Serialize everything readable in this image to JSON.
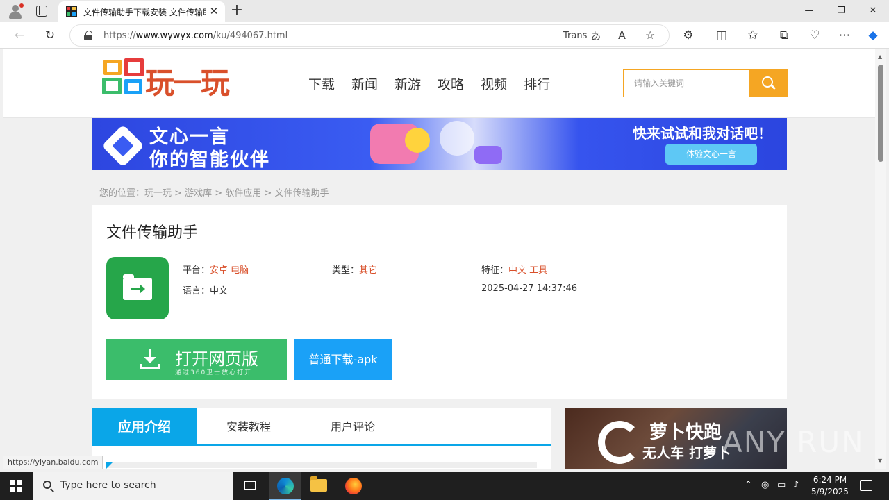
{
  "browser": {
    "tab_title": "文件传输助手下载安装 文件传输助手",
    "tab_close": "✕",
    "new_tab": "+",
    "window_controls": {
      "minimize": "—",
      "restore": "❐",
      "close": "✕"
    },
    "url_prefix": "https://",
    "url_host": "www.wywyx.com",
    "url_path": "/ku/494067.html",
    "translate_label": "Trans",
    "translate_glyph": "あ",
    "read_aloud_glyph": "A",
    "status_link": "https://yiyan.baidu.com"
  },
  "site": {
    "logo_text": "玩一玩",
    "nav": [
      "下载",
      "新闻",
      "新游",
      "攻略",
      "视频",
      "排行"
    ],
    "search_placeholder": "请输入关键词"
  },
  "banner": {
    "title_line1": "文心一言",
    "title_line2": "你的智能伙伴",
    "right_text": "快来试试和我对话吧！",
    "button_label": "体验文心一言"
  },
  "breadcrumb": "您的位置：玩一玩 > 游戏库 > 软件应用 > 文件传输助手",
  "app": {
    "title": "文件传输助手",
    "platform_label": "平台：",
    "platform_value": "安卓 电脑",
    "type_label": "类型：",
    "type_value": "其它",
    "feature_label": "特征：",
    "feature_value": "中文 工具",
    "language_label": "语言：",
    "language_value": "中文",
    "updated": "2025-04-27 14:37:46",
    "open_web_label": "打开网页版",
    "open_web_sub": "通过360卫士放心打开",
    "apk_label": "普通下载-apk"
  },
  "intro_tabs": [
    "应用介绍",
    "安装教程",
    "用户评论"
  ],
  "ad": {
    "line1": "萝卜快跑",
    "line2": "无人车 打萝卜"
  },
  "watermark": "ANY RUN",
  "taskbar": {
    "search_placeholder": "Type here to search",
    "time": "6:24 PM",
    "date": "5/9/2025"
  },
  "colors": {
    "accent_orange": "#f5a623",
    "download_green": "#3bbd6b",
    "apk_blue": "#1aa1f7",
    "tab_blue": "#0aa6e8",
    "value_red": "#d9502b",
    "app_icon_green": "#26a64a"
  }
}
